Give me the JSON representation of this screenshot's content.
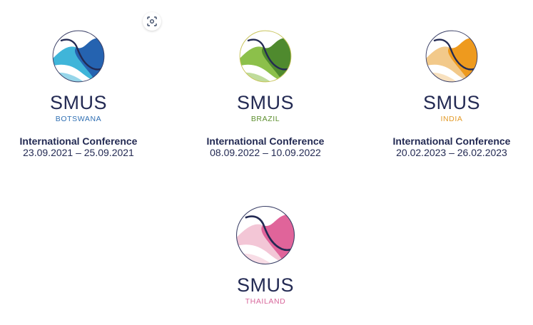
{
  "toolbar": {
    "scan_icon": "lens-scan-icon"
  },
  "conferences": [
    {
      "brand": "SMUS",
      "country": "BOTSWANA",
      "title": "International Conference",
      "dates": "23.09.2021 – 25.09.2021",
      "colors": {
        "light": "#3fb5d9",
        "dark": "#2563b0",
        "label": "#2f6fb3"
      }
    },
    {
      "brand": "SMUS",
      "country": "BRAZIL",
      "title": "International Conference",
      "dates": "08.09.2022 – 10.09.2022",
      "colors": {
        "light": "#8cc04a",
        "dark": "#4f8a2e",
        "label": "#5c8f2e"
      }
    },
    {
      "brand": "SMUS",
      "country": "INDIA",
      "title": "International Conference",
      "dates": "20.02.2023 – 26.02.2023",
      "colors": {
        "light": "#f2c98a",
        "dark": "#ee9a1e",
        "label": "#e39a27"
      }
    },
    {
      "brand": "SMUS",
      "country": "THAILAND",
      "colors": {
        "light": "#f3c6d6",
        "dark": "#e0649a",
        "label": "#d8679b"
      }
    }
  ],
  "colors": {
    "navy": "#232a53",
    "outline": "#3a3f66"
  }
}
